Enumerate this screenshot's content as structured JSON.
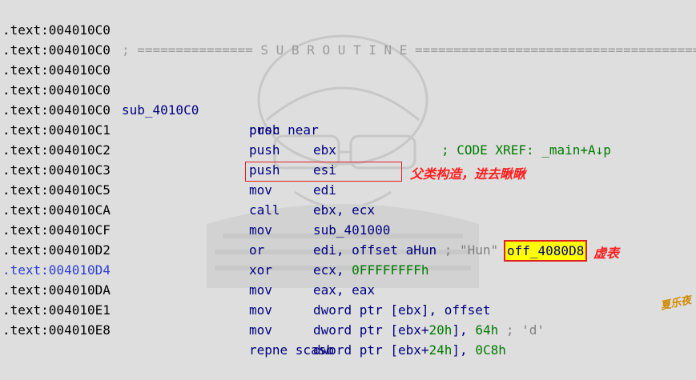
{
  "header": {
    "addr": ".text:004010C0",
    "separator": "; =============== S U B R O U T I N E ======================================="
  },
  "lines": [
    {
      "addr": ".text:004010C0",
      "label": "",
      "mnemonic": "",
      "operands": ""
    },
    {
      "addr": ".text:004010C0",
      "label": "",
      "mnemonic": "",
      "operands": ""
    },
    {
      "addr": ".text:004010C0",
      "label": "sub_4010C0",
      "mnemonic": "proc near",
      "operands": "",
      "xref": "; CODE XREF: _main+A↓p"
    },
    {
      "addr": ".text:004010C0",
      "mnemonic": "push",
      "operands": "ebx"
    },
    {
      "addr": ".text:004010C1",
      "mnemonic": "push",
      "operands": "esi"
    },
    {
      "addr": ".text:004010C2",
      "mnemonic": "push",
      "operands": "edi"
    },
    {
      "addr": ".text:004010C3",
      "mnemonic": "mov",
      "operands": "ebx, ecx"
    },
    {
      "addr": ".text:004010C5",
      "mnemonic": "call",
      "operands": "sub_401000"
    },
    {
      "addr": ".text:004010CA",
      "mnemonic": "mov",
      "operands_pre": "edi, offset aHun",
      "comment": " ; \"Hun\""
    },
    {
      "addr": ".text:004010CF",
      "mnemonic": "or",
      "operands_pre": "ecx, ",
      "num": "0FFFFFFFFh"
    },
    {
      "addr": ".text:004010D2",
      "mnemonic": "xor",
      "operands": "eax, eax"
    },
    {
      "addr": ".text:004010D4",
      "mnemonic": "mov",
      "operands": "dword ptr [ebx], offset",
      "target": "off_4080D8"
    },
    {
      "addr": ".text:004010DA",
      "mnemonic": "mov",
      "operands_pre": "dword ptr [ebx+",
      "num": "20h",
      "operands_mid": "], ",
      "num2": "64h",
      "comment": " ; 'd'"
    },
    {
      "addr": ".text:004010E1",
      "mnemonic": "mov",
      "operands_pre": "dword ptr [ebx+",
      "num": "24h",
      "operands_mid": "], ",
      "num2": "0C8h"
    },
    {
      "addr": ".text:004010E8",
      "mnemonic": "repne scasb",
      "operands": ""
    }
  ],
  "annotations": {
    "call_note": "父类构造，进去瞅瞅",
    "vtable_note": "虚表",
    "brand": "夏乐夜"
  },
  "colors": {
    "background": "#dedede",
    "code": "#00007f",
    "number": "#007a00",
    "comment": "#808080",
    "annotation": "#ff2020",
    "highlight": "#ffff00"
  }
}
